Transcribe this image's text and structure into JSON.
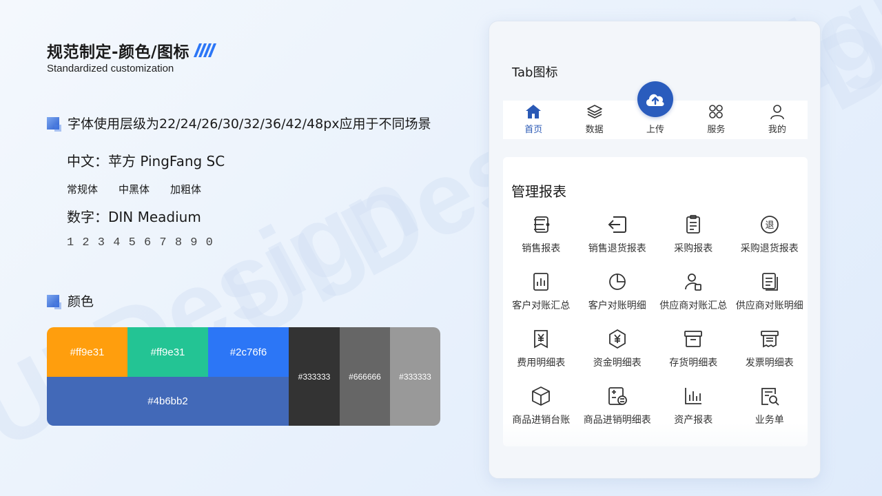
{
  "header": {
    "title": "规范制定-颜色/图标",
    "subtitle": "Standardized customization",
    "watermark": "UI Design"
  },
  "typography": {
    "levels_text": "字体使用层级为22/24/26/30/32/36/42/48px应用于不同场景",
    "cn_font": "中文：苹方 PingFang SC",
    "weights": [
      "常规体",
      "中黑体",
      "加粗体"
    ],
    "num_font": "数字：DIN Meadium",
    "digits": "1 2 3 4 5 6 7 8 9 0"
  },
  "colors": {
    "section_title": "颜色",
    "swatches": [
      {
        "label": "#ff9e31",
        "color": "#ff9e0d"
      },
      {
        "label": "#ff9e31",
        "color": "#23c494"
      },
      {
        "label": "#2c76f6",
        "color": "#2c76f6"
      },
      {
        "label": "#4b6bb2",
        "color": "#4269b8"
      },
      {
        "label": "#333333",
        "color": "#333333"
      },
      {
        "label": "#666666",
        "color": "#666666"
      },
      {
        "label": "#333333",
        "color": "#999999"
      }
    ]
  },
  "phone": {
    "tab_title": "Tab图标",
    "tabs": [
      {
        "label": "首页",
        "icon": "home-icon",
        "active": true
      },
      {
        "label": "数据",
        "icon": "layers-icon",
        "active": false
      },
      {
        "label": "上传",
        "icon": "cloud-upload-icon",
        "active": false
      },
      {
        "label": "服务",
        "icon": "apps-icon",
        "active": false
      },
      {
        "label": "我的",
        "icon": "user-icon",
        "active": false
      }
    ],
    "report_title": "管理报表",
    "reports": [
      {
        "label": "销售报表",
        "icon": "sales-list-icon"
      },
      {
        "label": "销售退货报表",
        "icon": "return-arrow-icon"
      },
      {
        "label": "采购报表",
        "icon": "clipboard-icon"
      },
      {
        "label": "采购退货报表",
        "icon": "return-badge-icon"
      },
      {
        "label": "客户对账汇总",
        "icon": "bar-doc-icon"
      },
      {
        "label": "客户对账明细",
        "icon": "pie-icon"
      },
      {
        "label": "供应商对账汇总",
        "icon": "supplier-user-icon"
      },
      {
        "label": "供应商对账明细",
        "icon": "docs-icon"
      },
      {
        "label": "费用明细表",
        "icon": "yen-bookmark-icon"
      },
      {
        "label": "资金明细表",
        "icon": "yen-hex-icon"
      },
      {
        "label": "存货明细表",
        "icon": "inventory-box-icon"
      },
      {
        "label": "发票明细表",
        "icon": "invoice-icon"
      },
      {
        "label": "商品进销台账",
        "icon": "cube-icon"
      },
      {
        "label": "商品进销明细表",
        "icon": "calc-exchange-icon"
      },
      {
        "label": "资产报表",
        "icon": "bar-chart-icon"
      },
      {
        "label": "业务单",
        "icon": "search-doc-icon"
      }
    ]
  }
}
